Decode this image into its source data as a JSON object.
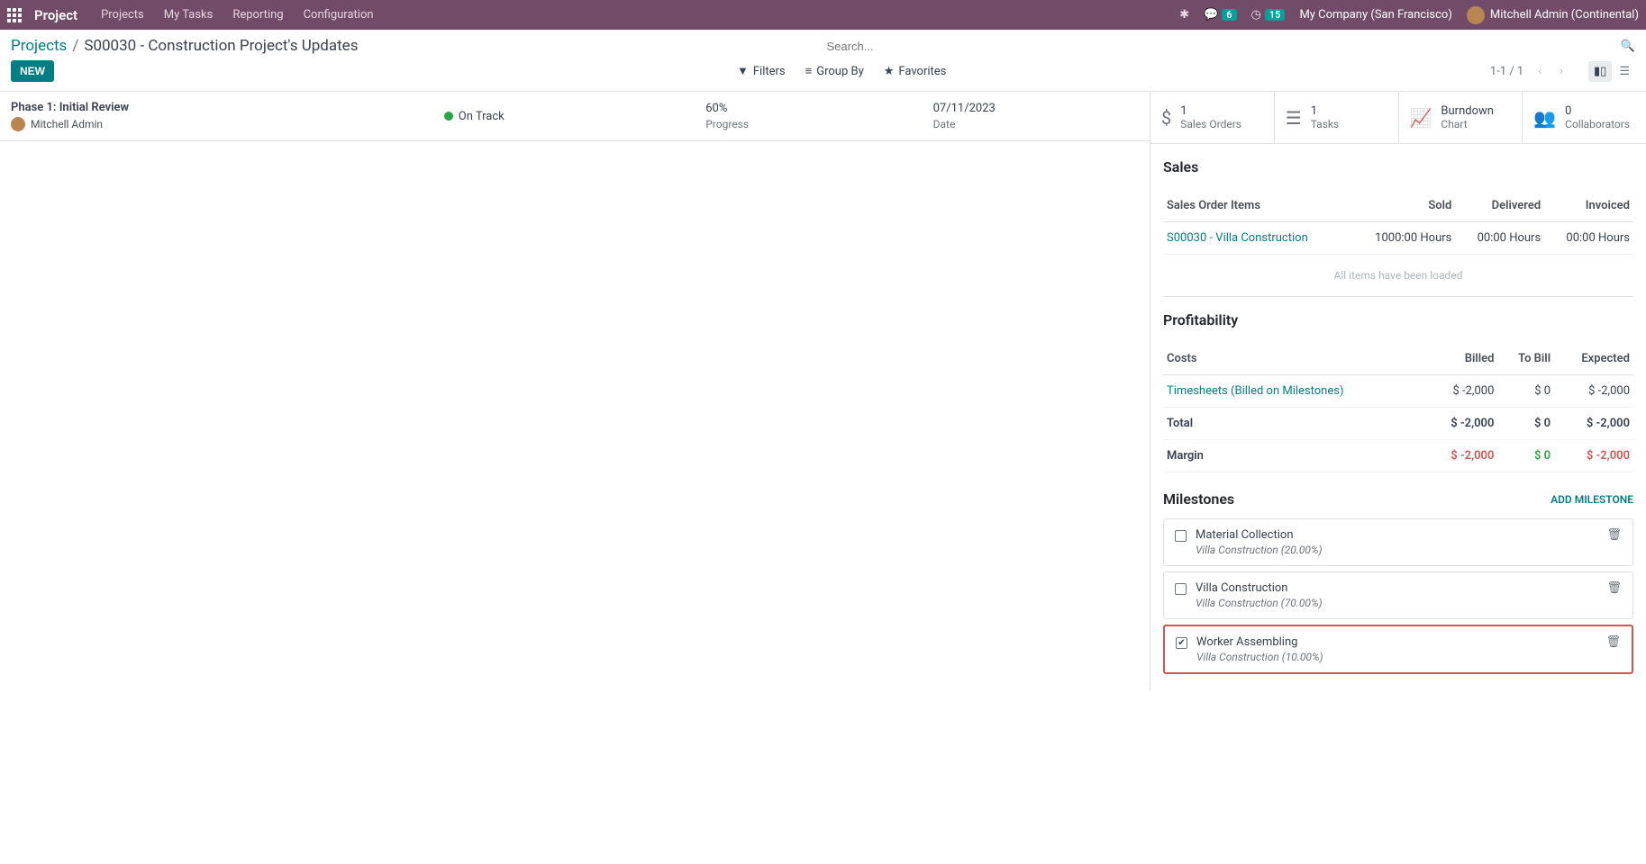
{
  "navbar": {
    "brand": "Project",
    "menu": [
      "Projects",
      "My Tasks",
      "Reporting",
      "Configuration"
    ],
    "messages_badge": "6",
    "activities_badge": "15",
    "company": "My Company (San Francisco)",
    "user": "Mitchell Admin (Continental)"
  },
  "breadcrumb": {
    "root": "Projects",
    "current": "S00030 - Construction Project's Updates"
  },
  "search": {
    "placeholder": "Search..."
  },
  "buttons": {
    "new": "NEW"
  },
  "filters": {
    "filters": "Filters",
    "groupby": "Group By",
    "favorites": "Favorites"
  },
  "pager": {
    "range": "1-1 / 1"
  },
  "update": {
    "title": "Phase 1: Initial Review",
    "user": "Mitchell Admin",
    "status": "On Track",
    "progress_value": "60%",
    "progress_label": "Progress",
    "date_value": "07/11/2023",
    "date_label": "Date"
  },
  "stats": {
    "sales_orders": {
      "num": "1",
      "label": "Sales Orders"
    },
    "tasks": {
      "num": "1",
      "label": "Tasks"
    },
    "burndown": {
      "line1": "Burndown",
      "line2": "Chart"
    },
    "collaborators": {
      "num": "0",
      "label": "Collaborators"
    }
  },
  "sales": {
    "title": "Sales",
    "headers": {
      "items": "Sales Order Items",
      "sold": "Sold",
      "delivered": "Delivered",
      "invoiced": "Invoiced"
    },
    "row": {
      "name": "S00030 - Villa Construction",
      "sold": "1000:00 Hours",
      "delivered": "00:00 Hours",
      "invoiced": "00:00 Hours"
    },
    "all_loaded": "All items have been loaded"
  },
  "profitability": {
    "title": "Profitability",
    "headers": {
      "costs": "Costs",
      "billed": "Billed",
      "tobill": "To Bill",
      "expected": "Expected"
    },
    "row": {
      "name": "Timesheets (Billed on Milestones)",
      "billed": "$ -2,000",
      "tobill": "$ 0",
      "expected": "$ -2,000"
    },
    "total": {
      "label": "Total",
      "billed": "$ -2,000",
      "tobill": "$ 0",
      "expected": "$ -2,000"
    },
    "margin": {
      "label": "Margin",
      "billed": "$ -2,000",
      "tobill": "$ 0",
      "expected": "$ -2,000"
    }
  },
  "milestones": {
    "title": "Milestones",
    "add": "ADD MILESTONE",
    "items": [
      {
        "checked": false,
        "name": "Material Collection",
        "sub": "Villa Construction (20.00%)"
      },
      {
        "checked": false,
        "name": "Villa Construction",
        "sub": "Villa Construction (70.00%)"
      },
      {
        "checked": true,
        "name": "Worker Assembling",
        "sub": "Villa Construction (10.00%)"
      }
    ]
  }
}
